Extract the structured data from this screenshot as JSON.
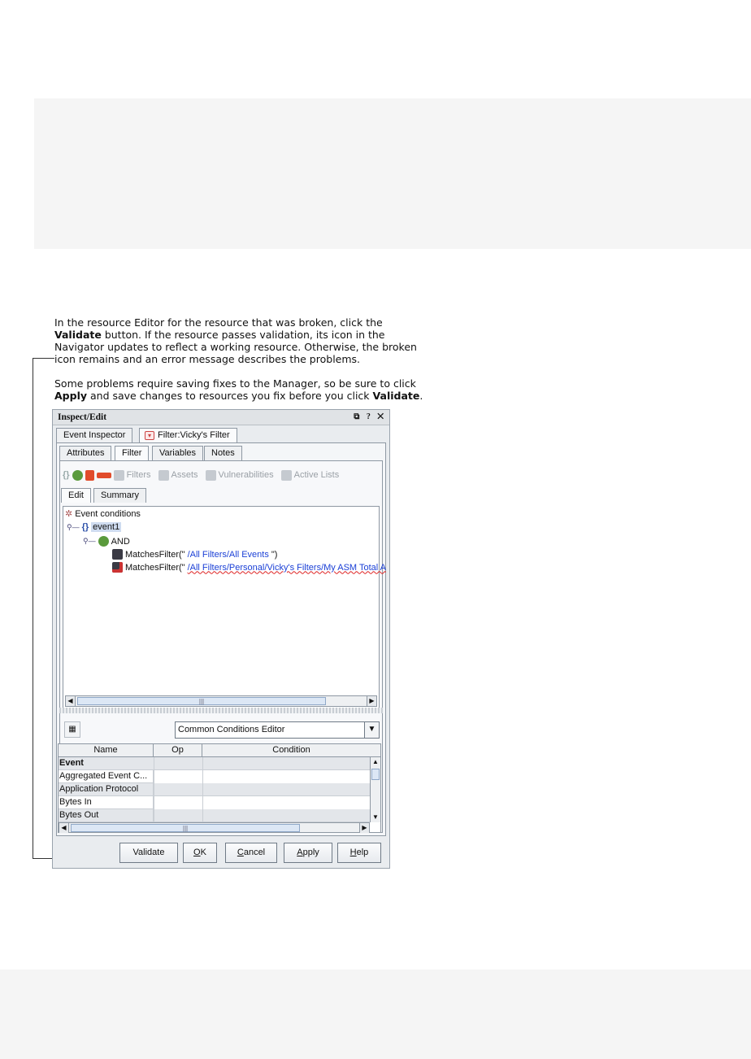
{
  "callout": {
    "p1_a": "In the resource Editor for the resource that was broken, click the ",
    "p1_b": "Validate",
    "p1_c": " button. If the resource passes validation, its icon in the Navigator updates to reflect a working resource. Otherwise, the broken icon remains and an error message describes the problems.",
    "p2_a": "Some problems require saving fixes to the Manager, so be sure to click ",
    "p2_b": "Apply",
    "p2_c": " and save changes to resources you fix before you click ",
    "p2_d": "Validate",
    "p2_e": "."
  },
  "window": {
    "title": "Inspect/Edit",
    "controls": "⧉ ? ✕",
    "top_tabs": [
      "Event Inspector",
      "Filter:Vicky's Filter"
    ],
    "sub_tabs": [
      "Attributes",
      "Filter",
      "Variables",
      "Notes"
    ],
    "toolbar": {
      "filters": "Filters",
      "assets": "Assets",
      "vulnerabilities": "Vulnerabilities",
      "active_lists": "Active Lists"
    },
    "editor_tabs": [
      "Edit",
      "Summary"
    ],
    "tree": {
      "root": "Event conditions",
      "event": "event1",
      "and": "AND",
      "m1_prefix": "MatchesFilter(\"",
      "m1_link": "/All Filters/All Events",
      "m1_suffix": "\")",
      "m2_prefix": "MatchesFilter(\"",
      "m2_link": "/All Filters/Personal/Vicky's Filters/My ASM Total A"
    },
    "scroll_grip": "|||",
    "combo_value": "Common Conditions Editor",
    "grid": {
      "headers": [
        "Name",
        "Op",
        "Condition"
      ],
      "rows": [
        "Event",
        "Aggregated Event C...",
        "Application Protocol",
        "Bytes In",
        "Bytes Out"
      ]
    },
    "buttons": {
      "validate": "Validate",
      "ok_u": "O",
      "ok_rest": "K",
      "cancel_u": "C",
      "cancel_rest": "ancel",
      "apply_u": "A",
      "apply_rest": "pply",
      "help_u": "H",
      "help_rest": "elp"
    }
  }
}
